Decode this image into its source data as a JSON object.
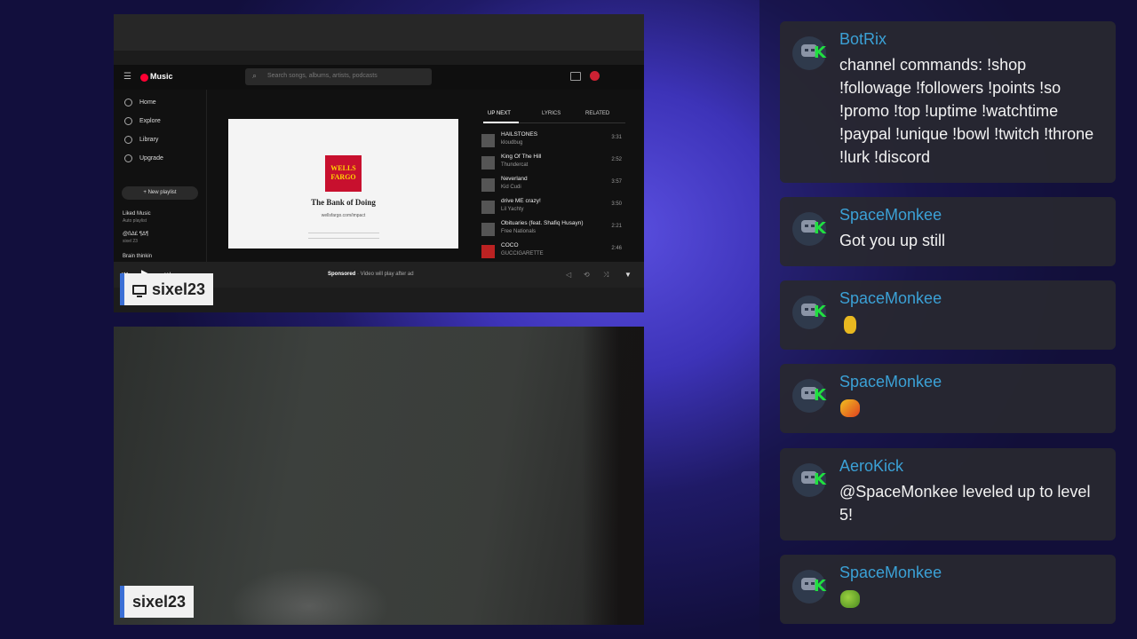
{
  "screen_share": {
    "app": {
      "logo": "Music",
      "search_placeholder": "Search songs, albums, artists, podcasts",
      "nav": [
        {
          "label": "Home",
          "icon": "home-icon"
        },
        {
          "label": "Explore",
          "icon": "compass-icon"
        },
        {
          "label": "Library",
          "icon": "library-icon"
        },
        {
          "label": "Upgrade",
          "icon": "upgrade-icon"
        }
      ],
      "new_playlist": "New playlist",
      "playlists": [
        {
          "title": "Liked Music",
          "sub": "Auto playlist"
        },
        {
          "title": "@ßΔ£ ¶Δ¶",
          "sub": "sixel 23"
        },
        {
          "title": "Brain thinkin",
          "sub": ""
        }
      ],
      "ad": {
        "brand_line1": "WELLS",
        "brand_line2": "FARGO",
        "tagline": "The Bank of Doing",
        "url": "wellsfargo.com/impact"
      },
      "queue_tabs": [
        "UP NEXT",
        "LYRICS",
        "RELATED"
      ],
      "tracks": [
        {
          "title": "HAILSTONES",
          "artist": "kloudbug",
          "duration": "3:31"
        },
        {
          "title": "King Of The Hill",
          "artist": "Thundercat",
          "duration": "2:52"
        },
        {
          "title": "Neverland",
          "artist": "Kid Cudi",
          "duration": "3:57"
        },
        {
          "title": "drive ME crazy!",
          "artist": "Lil Yachty",
          "duration": "3:50"
        },
        {
          "title": "Obituaries (feat. Shafiq Husayn)",
          "artist": "Free Nationals",
          "duration": "2:21"
        },
        {
          "title": "COCO",
          "artist": "GUCCIGARETTE",
          "duration": "2:46"
        }
      ],
      "player_status_bold": "Sponsored",
      "player_status": " · Video will play after ad"
    },
    "name_tag": "sixel23"
  },
  "camera": {
    "name_tag": "sixel23"
  },
  "chat": [
    {
      "user": "BotRix",
      "text": "channel commands: !shop !followage !followers !points !so !promo !top !uptime !watchtime !paypal !unique !bowl !twitch !throne !lurk !discord"
    },
    {
      "user": "SpaceMonkee",
      "text": "Got you up still"
    },
    {
      "user": "SpaceMonkee",
      "text": "",
      "emote": "banana-emote",
      "emote_color": "#e8b820"
    },
    {
      "user": "SpaceMonkee",
      "text": "",
      "emote": "pepe-emote",
      "emote_color": "#e04020"
    },
    {
      "user": "AeroKick",
      "text": "@SpaceMonkee leveled up to level 5!"
    },
    {
      "user": "SpaceMonkee",
      "text": "",
      "emote": "frog-emote",
      "emote_color": "#6cb030"
    }
  ],
  "colors": {
    "username": "#3ba1d6",
    "kick_green": "#20e040",
    "name_tag_accent": "#3b6fd6"
  }
}
